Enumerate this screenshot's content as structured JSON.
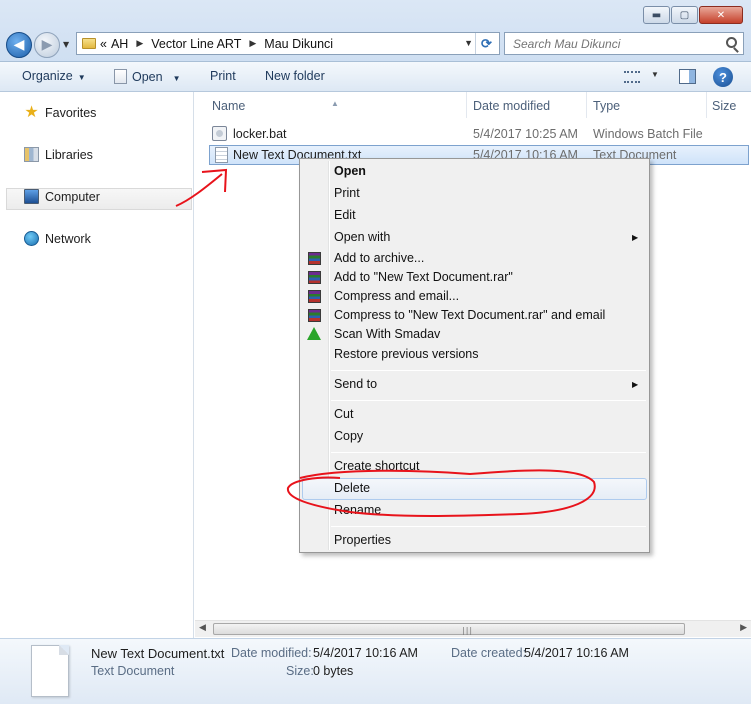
{
  "titlebar": {
    "minimize_glyph": "▬",
    "maximize_glyph": "▢",
    "close_glyph": "✕"
  },
  "nav": {
    "back_glyph": "◀",
    "forward_glyph": "▶",
    "dropdown_glyph": "▼"
  },
  "address": {
    "overflow": "«",
    "crumbs": [
      "AH",
      "Vector Line ART",
      "Mau Dikunci"
    ],
    "separator": "▶",
    "dropdown_glyph": "▼",
    "refresh_glyph": "⟳"
  },
  "search": {
    "placeholder": "Search Mau Dikunci"
  },
  "toolbar": {
    "organize": "Organize",
    "open": "Open",
    "print": "Print",
    "new_folder": "New folder",
    "dropdown_glyph": "▼",
    "help_glyph": "?"
  },
  "navpane": {
    "items": [
      {
        "label": "Favorites",
        "icon": "star-icon"
      },
      {
        "label": "Libraries",
        "icon": "libraries-icon"
      },
      {
        "label": "Computer",
        "icon": "computer-icon"
      },
      {
        "label": "Network",
        "icon": "network-icon"
      }
    ]
  },
  "columns": {
    "name": "Name",
    "date_modified": "Date modified",
    "type": "Type",
    "size": "Size",
    "sort_glyph": "▲"
  },
  "files": [
    {
      "name": "locker.bat",
      "date": "5/4/2017 10:25 AM",
      "type": "Windows Batch File",
      "icon": "batch-file-icon"
    },
    {
      "name": "New Text Document.txt",
      "date": "5/4/2017 10:16 AM",
      "type": "Text Document",
      "icon": "text-file-icon"
    }
  ],
  "context_menu": {
    "items": {
      "open": "Open",
      "print": "Print",
      "edit": "Edit",
      "open_with": "Open with",
      "add_to_archive": "Add to archive...",
      "add_to_rar": "Add to \"New Text Document.rar\"",
      "compress_email": "Compress and email...",
      "compress_rar_email": "Compress to \"New Text Document.rar\" and email",
      "scan_smadav": "Scan With Smadav",
      "restore_versions": "Restore previous versions",
      "send_to": "Send to",
      "cut": "Cut",
      "copy": "Copy",
      "create_shortcut": "Create shortcut",
      "delete": "Delete",
      "rename": "Rename",
      "properties": "Properties"
    },
    "submenu_glyph": "▶"
  },
  "scrollbar": {
    "left_glyph": "◀",
    "right_glyph": "▶",
    "grip": "|||"
  },
  "details": {
    "filename": "New Text Document.txt",
    "filetype": "Text Document",
    "date_modified_label": "Date modified:",
    "date_modified": "5/4/2017 10:16 AM",
    "date_created_label": "Date created:",
    "date_created": "5/4/2017 10:16 AM",
    "size_label": "Size:",
    "size": "0 bytes"
  },
  "colors": {
    "annotation": "#e8131b",
    "selection_border": "#7da2ce",
    "hover_border": "#aecbee"
  }
}
